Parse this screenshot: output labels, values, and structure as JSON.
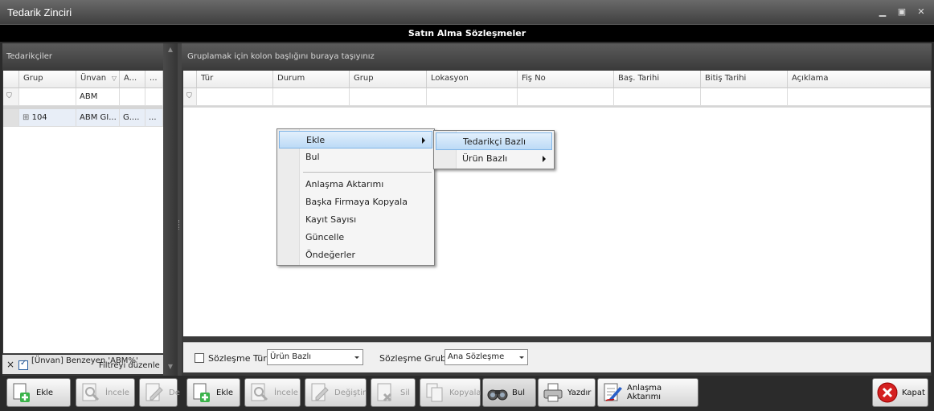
{
  "window": {
    "title": "Tedarik Zinciri",
    "minimize": "▁",
    "maximize": "▣",
    "close": "✕"
  },
  "form_title": "Satın Alma Sözleşmeler",
  "left_panel": {
    "title": "Tedarikçiler",
    "columns": [
      "Grup",
      "Ünvan",
      "A...",
      "..."
    ],
    "filter_row": [
      "",
      "ABM",
      "",
      ""
    ],
    "rows": [
      {
        "expander": "⊞",
        "cells": [
          "104",
          "ABM GI...",
          "G....",
          "..."
        ]
      }
    ],
    "filter_text": "[Ünvan] Benzeyen 'ABM%'",
    "filter_edit": "Filtreyi düzenle",
    "filter_close": "×",
    "buttons": {
      "add": "Ekle",
      "inspect": "İncele",
      "edit": "De"
    }
  },
  "main_panel": {
    "group_hint": "Gruplamak için kolon başlığını buraya taşıyınız",
    "columns": [
      "Tür",
      "Durum",
      "Grup",
      "Lokasyon",
      "Fiş No",
      "Baş. Tarihi",
      "Bitiş Tarihi",
      "Açıklama"
    ]
  },
  "context_menu": {
    "items": [
      "Ekle",
      "Bul",
      "Anlaşma Aktarımı",
      "Başka Firmaya Kopyala",
      "Kayıt Sayısı",
      "Güncelle",
      "Öndeğerler"
    ],
    "submenu": [
      "Tedarikçi Bazlı",
      "Ürün Bazlı"
    ]
  },
  "filters": {
    "contract_type_label": "Sözleşme Türü",
    "contract_type_value": "Ürün Bazlı",
    "contract_group_label": "Sözleşme Grubu",
    "contract_group_value": "Ana Sözleşme"
  },
  "toolbar": {
    "add": "Ekle",
    "inspect": "İncele",
    "edit": "Değiştir",
    "delete": "Sil",
    "copy": "Kopyala",
    "find": "Bul",
    "print": "Yazdır",
    "transfer": "Anlaşma Aktarımı",
    "close": "Kapat"
  }
}
